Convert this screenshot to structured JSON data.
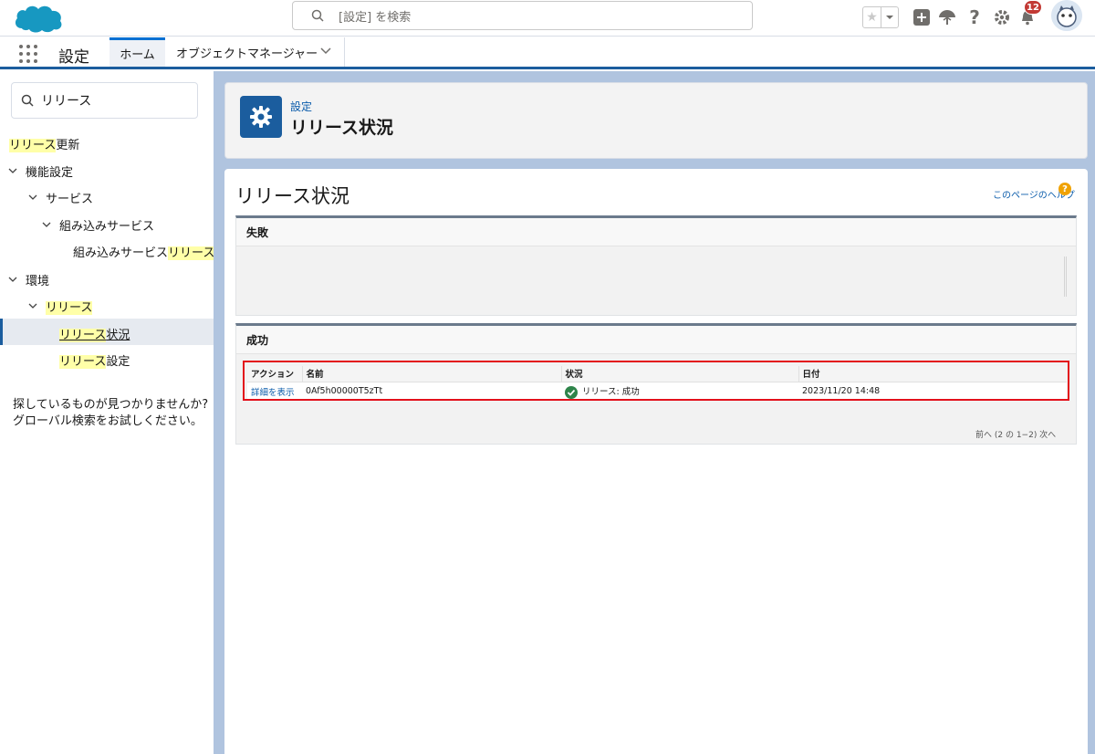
{
  "header": {
    "search_placeholder": "[設定] を検索",
    "notification_count": "12"
  },
  "nav": {
    "app_name": "設定",
    "tabs": [
      {
        "label": "ホーム"
      },
      {
        "label": "オブジェクトマネージャー"
      }
    ]
  },
  "sidebar": {
    "search_value": "リリース",
    "items": [
      {
        "hl": "リリース",
        "rest": "更新"
      },
      {
        "label": "機能設定"
      },
      {
        "label": "サービス"
      },
      {
        "label": "組み込みサービス"
      },
      {
        "pre": "組み込みサービス",
        "hl": "リリース"
      },
      {
        "label": "環境"
      },
      {
        "hl": "リリース"
      },
      {
        "hl": "リリース",
        "rest": "状況"
      },
      {
        "hl": "リリース",
        "rest": "設定"
      }
    ],
    "help_line1": "探しているものが見つかりませんか?",
    "help_line2": "グローバル検索をお試しください。"
  },
  "page_header": {
    "breadcrumb": "設定",
    "title": "リリース状況"
  },
  "content": {
    "title": "リリース状況",
    "help_link": "このページのヘルプ",
    "failed_section": "失敗",
    "success_section": "成功",
    "table": {
      "headers": [
        "アクション",
        "名前",
        "状況",
        "日付"
      ],
      "rows": [
        {
          "action": "詳細を表示",
          "name": "0Af5h00000T5zTt",
          "status": "リリース: 成功",
          "date": "2023/11/20 14:48"
        }
      ]
    },
    "pager": "前へ (2 の 1−2) 次へ"
  },
  "colors": {
    "brand": "#1b5d9e",
    "highlight": "#ffffa8",
    "link": "#0b5cab",
    "success": "#2e844a",
    "annotation_box": "#e3111b"
  }
}
